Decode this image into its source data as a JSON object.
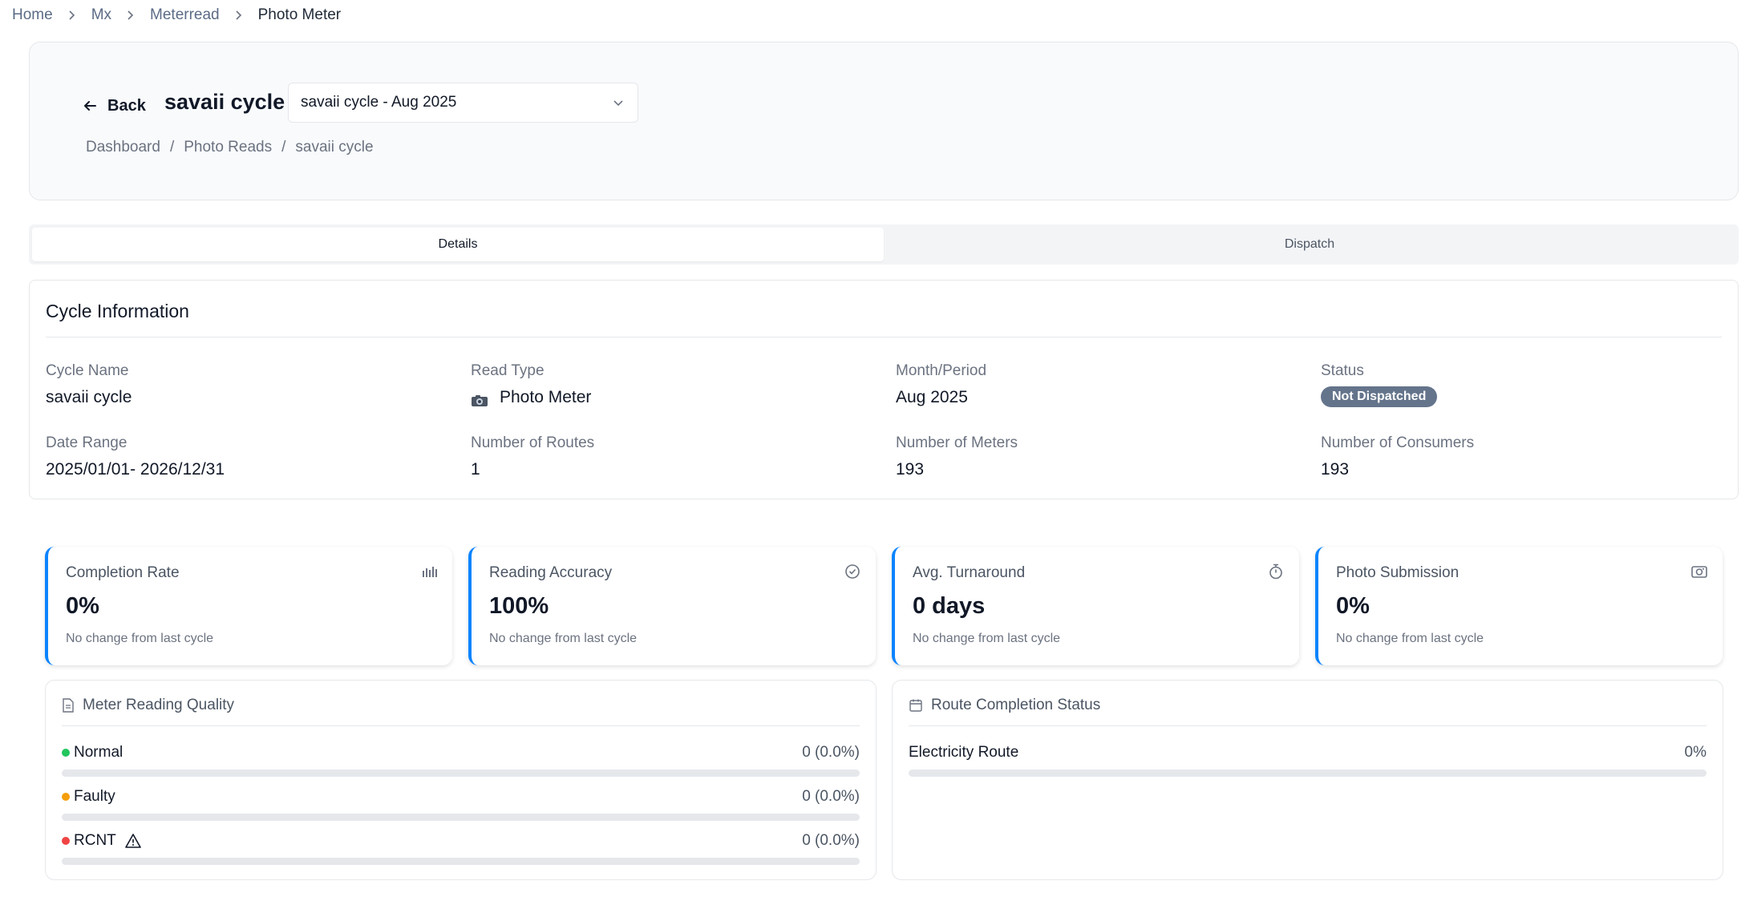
{
  "breadcrumb": {
    "items": [
      "Home",
      "Mx",
      "Meterread"
    ],
    "current": "Photo Meter"
  },
  "header": {
    "back_label": "Back",
    "title": "savaii cycle",
    "select_value": "savaii cycle - Aug 2025",
    "sub_breadcrumb": [
      "Dashboard",
      "Photo Reads",
      "savaii cycle"
    ]
  },
  "tabs": [
    {
      "label": "Details",
      "active": true
    },
    {
      "label": "Dispatch",
      "active": false
    }
  ],
  "cycle_info": {
    "title": "Cycle Information",
    "fields": {
      "cycle_name": {
        "label": "Cycle Name",
        "value": "savaii cycle"
      },
      "read_type": {
        "label": "Read Type",
        "value": "Photo Meter",
        "icon": "camera-icon"
      },
      "month_period": {
        "label": "Month/Period",
        "value": "Aug 2025"
      },
      "status": {
        "label": "Status",
        "value": "Not Dispatched"
      },
      "date_range": {
        "label": "Date Range",
        "value": "2025/01/01- 2026/12/31"
      },
      "routes": {
        "label": "Number of Routes",
        "value": "1"
      },
      "meters": {
        "label": "Number of Meters",
        "value": "193"
      },
      "consumers": {
        "label": "Number of Consumers",
        "value": "193"
      }
    }
  },
  "metrics": [
    {
      "title": "Completion Rate",
      "value": "0%",
      "note": "No change from last cycle",
      "icon": "bar-chart-icon"
    },
    {
      "title": "Reading Accuracy",
      "value": "100%",
      "note": "No change from last cycle",
      "icon": "check-circle-icon"
    },
    {
      "title": "Avg. Turnaround",
      "value": "0 days",
      "note": "No change from last cycle",
      "icon": "stopwatch-icon"
    },
    {
      "title": "Photo Submission",
      "value": "0%",
      "note": "No change from last cycle",
      "icon": "camera-icon"
    }
  ],
  "quality": {
    "title": "Meter Reading Quality",
    "rows": [
      {
        "label": "Normal",
        "value": "0 (0.0%)",
        "color": "#22c55e",
        "fraction": 0
      },
      {
        "label": "Faulty",
        "value": "0 (0.0%)",
        "color": "#f59e0b",
        "fraction": 0
      },
      {
        "label": "RCNT",
        "value": "0 (0.0%)",
        "color": "#ef4444",
        "fraction": 0,
        "icon": "warning-icon"
      }
    ]
  },
  "routes": {
    "title": "Route Completion Status",
    "rows": [
      {
        "label": "Electricity Route",
        "value": "0%",
        "fraction": 0
      }
    ]
  },
  "colors": {
    "accent": "#0b84ff",
    "badge": "#64748b"
  }
}
